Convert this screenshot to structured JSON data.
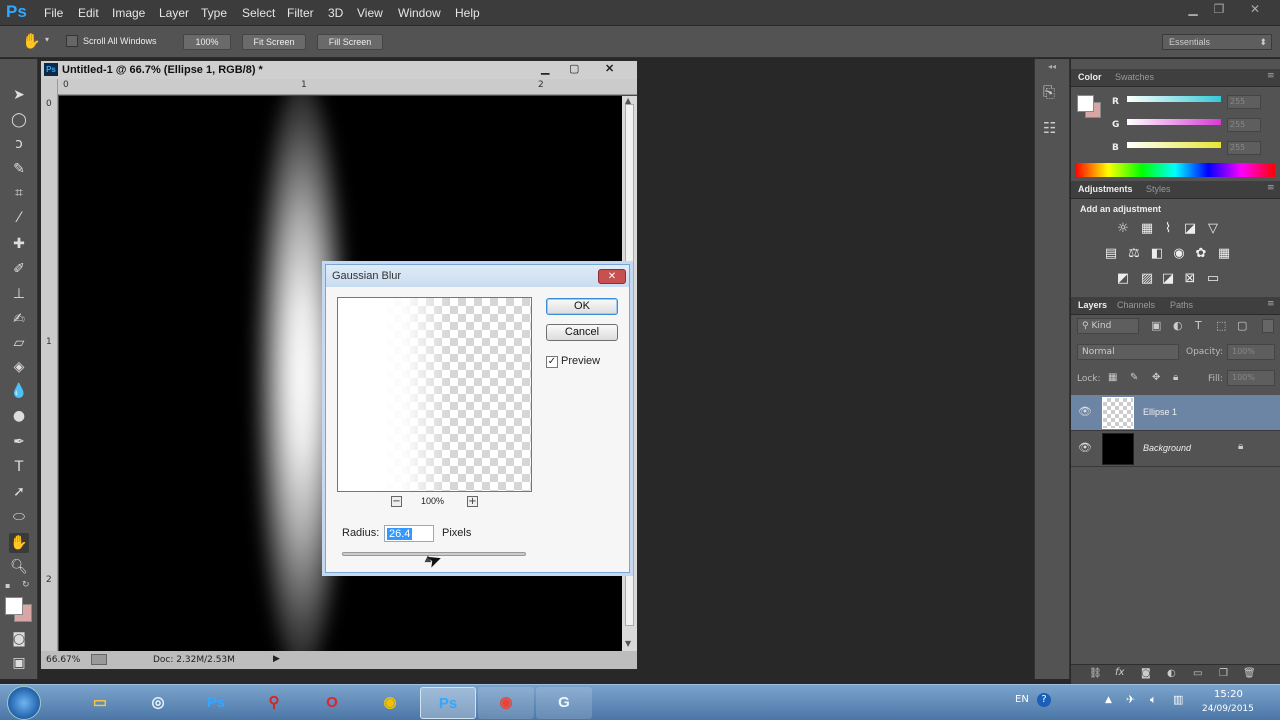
{
  "app": {
    "logo": "Ps",
    "menu": [
      "File",
      "Edit",
      "Image",
      "Layer",
      "Type",
      "Select",
      "Filter",
      "3D",
      "View",
      "Window",
      "Help"
    ]
  },
  "options_bar": {
    "scroll_all_windows": "Scroll All Windows",
    "zoom_100": "100%",
    "fit_screen": "Fit Screen",
    "fill_screen": "Fill Screen",
    "workspace": "Essentials"
  },
  "document": {
    "title": "Untitled-1 @ 66.7% (Ellipse 1, RGB/8) *",
    "ruler_top": [
      "0",
      "1",
      "2"
    ],
    "ruler_left": [
      "0",
      "1",
      "2"
    ],
    "zoom": "66.67%",
    "doc_size": "Doc: 2.32M/2.53M"
  },
  "dialog": {
    "title": "Gaussian Blur",
    "ok": "OK",
    "cancel": "Cancel",
    "preview": "Preview",
    "preview_checked": "✓",
    "zoom": "100%",
    "zoom_minus": "−",
    "zoom_plus": "+",
    "radius_label": "Radius:",
    "radius_value": "26.4",
    "radius_unit": "Pixels",
    "radius_slider_fraction": 0.47
  },
  "color_panel": {
    "tabs": [
      "Color",
      "Swatches"
    ],
    "channels": [
      {
        "label": "R",
        "value": "255",
        "color": "#35c9d6"
      },
      {
        "label": "G",
        "value": "255",
        "color": "#d63ad6"
      },
      {
        "label": "B",
        "value": "255",
        "color": "#e6e632"
      }
    ]
  },
  "adjustments_panel": {
    "tabs": [
      "Adjustments",
      "Styles"
    ],
    "heading": "Add an adjustment"
  },
  "layers_panel": {
    "tabs": [
      "Layers",
      "Channels",
      "Paths"
    ],
    "kind": "Kind",
    "blend_mode": "Normal",
    "opacity_label": "Opacity:",
    "opacity_value": "100%",
    "lock_label": "Lock:",
    "fill_label": "Fill:",
    "fill_value": "100%",
    "layers": [
      {
        "name": "Ellipse 1",
        "selected": true
      },
      {
        "name": "Background",
        "selected": false
      }
    ]
  },
  "taskbar": {
    "lang": "EN",
    "time": "15:20",
    "date": "24/09/2015"
  }
}
